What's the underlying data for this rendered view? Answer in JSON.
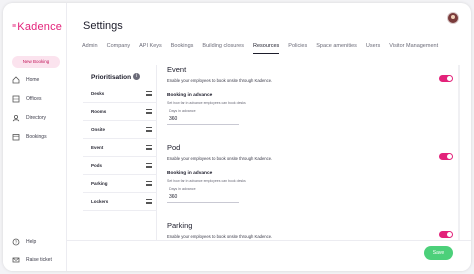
{
  "app": {
    "logo": "Kadence",
    "logo_mark": "≡"
  },
  "sidebar": {
    "new_booking_label": "New Booking",
    "items": [
      {
        "label": "Home",
        "icon": "home-icon"
      },
      {
        "label": "Offices",
        "icon": "offices-icon"
      },
      {
        "label": "Directory",
        "icon": "directory-icon"
      },
      {
        "label": "Bookings",
        "icon": "bookings-icon"
      }
    ],
    "bottom_items": [
      {
        "label": "Help",
        "icon": "help-icon"
      },
      {
        "label": "Raise ticket",
        "icon": "ticket-icon"
      }
    ]
  },
  "header": {
    "title": "Settings"
  },
  "tabs": [
    {
      "label": "Admin"
    },
    {
      "label": "Company"
    },
    {
      "label": "API Keys"
    },
    {
      "label": "Bookings"
    },
    {
      "label": "Building closures"
    },
    {
      "label": "Resources",
      "active": true
    },
    {
      "label": "Policies"
    },
    {
      "label": "Space amenities"
    },
    {
      "label": "Users"
    },
    {
      "label": "Visitor Management"
    }
  ],
  "prioritisation": {
    "title": "Prioritisation",
    "info_glyph": "i",
    "items": [
      "Desks",
      "Rooms",
      "Onsite",
      "Event",
      "Pods",
      "Parking",
      "Lockers"
    ]
  },
  "sections": [
    {
      "title": "Event",
      "desc": "Enable your employees to book onsite through Kadence.",
      "enabled": true,
      "sub_title": "Booking in advance",
      "sub_desc": "Set how far in advance employees can book desks",
      "field_label": "Days in advance",
      "field_value": "360"
    },
    {
      "title": "Pod",
      "desc": "Enable your employees to book onsite through Kadence.",
      "enabled": true,
      "sub_title": "Booking in advance",
      "sub_desc": "Set how far in advance employees can book desks",
      "field_label": "Days in advance",
      "field_value": "360"
    },
    {
      "title": "Parking",
      "desc": "Enable your employees to book onsite through Kadence.",
      "enabled": true
    }
  ],
  "footer": {
    "save_label": "Save"
  },
  "colors": {
    "brand": "#e3227a",
    "save": "#4cd07a"
  }
}
